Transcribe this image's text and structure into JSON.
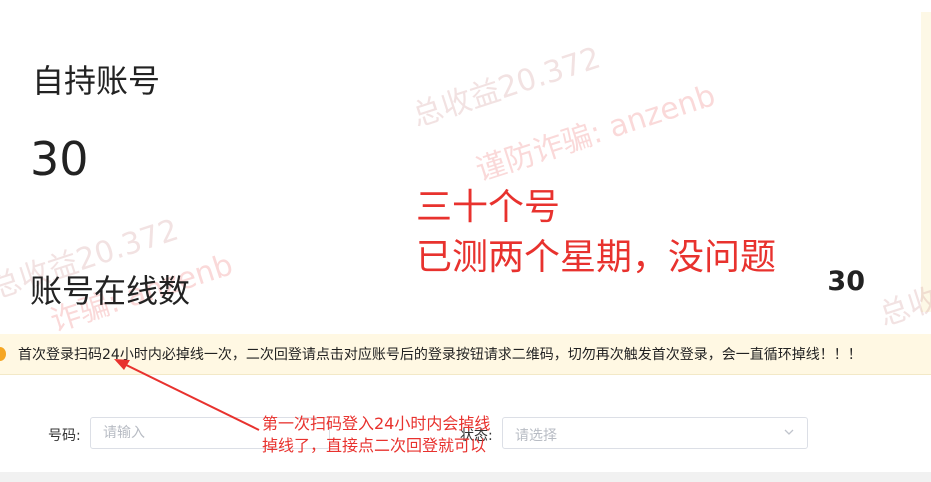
{
  "stats": {
    "self_accounts_label": "自持账号",
    "self_accounts_value": "30",
    "online_label": "账号在线数",
    "online_value": "30"
  },
  "watermarks": {
    "total_income_1": "总收益20.372",
    "anti_fraud": "谨防诈骗: anzenb",
    "total_income_2": "总收益20.372",
    "anti_fraud_short": "诈骗: anzenb",
    "edge_fragment": "总收"
  },
  "annotations": {
    "top_line1": "三十个号",
    "top_line2": "已测两个星期，没问题",
    "bottom_line1": "第一次扫码登入24小时内会掉线",
    "bottom_line2": "掉线了，直接点二次回登就可以"
  },
  "notice": {
    "text": "首次登录扫码24小时内必掉线一次，二次回登请点击对应账号后的登录按钮请求二维码，切勿再次触发首次登录，会一直循环掉线！！！"
  },
  "filters": {
    "number_label": "号码:",
    "number_placeholder": "请输入",
    "status_label": "状态:",
    "status_placeholder": "请选择"
  },
  "colors": {
    "annotation_red": "#e8322e",
    "notice_bg": "#fff8e3",
    "notice_icon": "#f5a623"
  }
}
